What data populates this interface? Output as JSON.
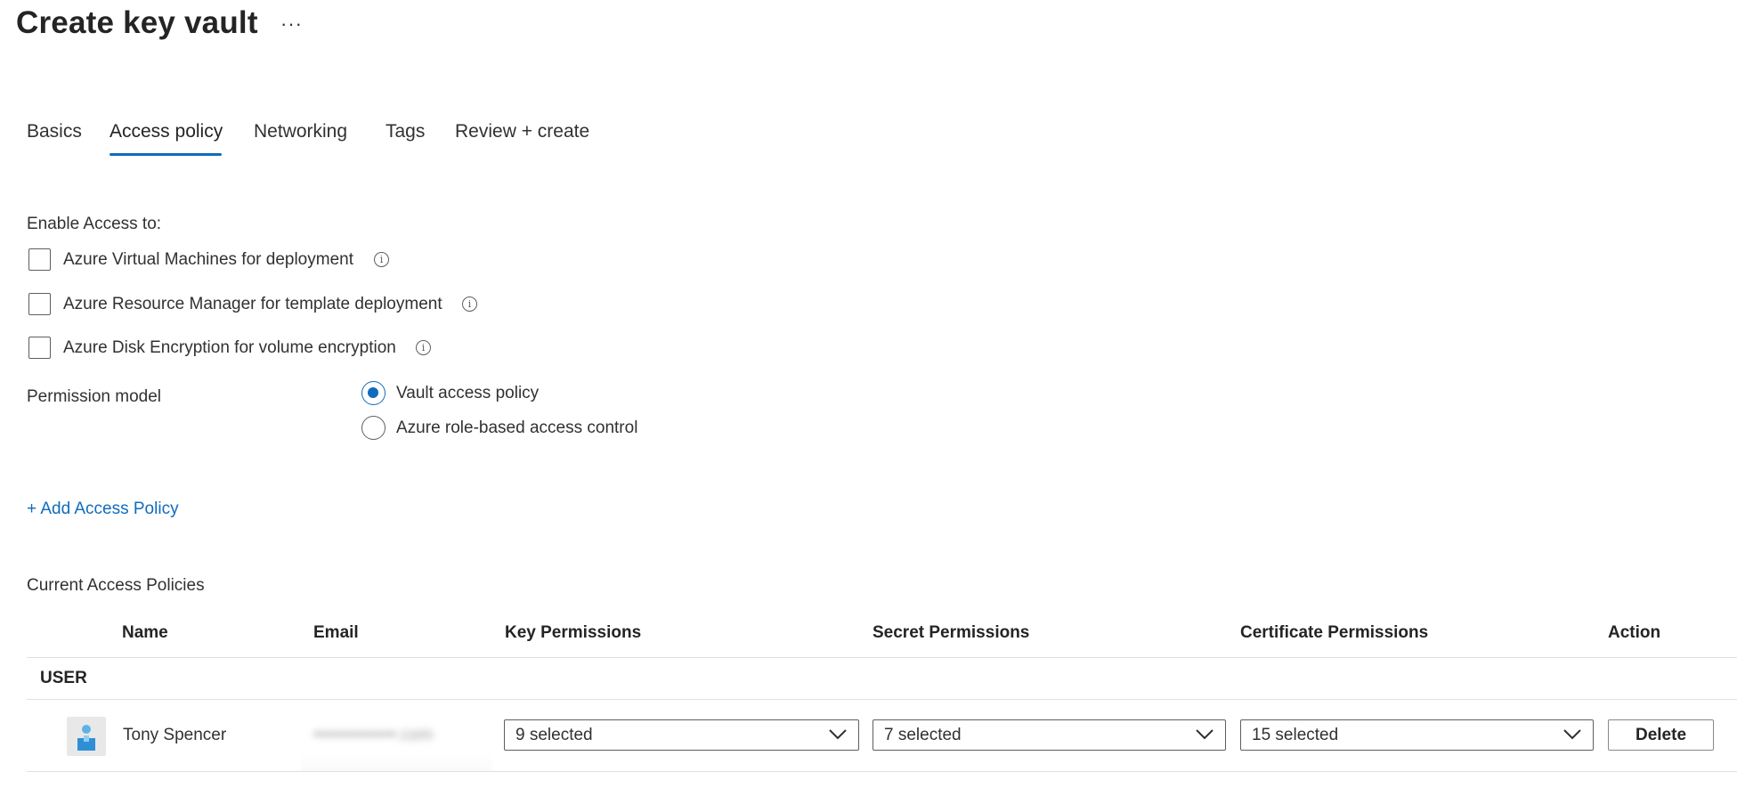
{
  "page": {
    "title": "Create key vault",
    "more_label": "···"
  },
  "tabs": [
    {
      "label": "Basics"
    },
    {
      "label": "Access policy",
      "active": true
    },
    {
      "label": "Networking"
    },
    {
      "label": "Tags"
    },
    {
      "label": "Review + create"
    }
  ],
  "access": {
    "heading": "Enable Access to:",
    "options": [
      {
        "label": "Azure Virtual Machines for deployment",
        "checked": false,
        "info_icon": "info-icon"
      },
      {
        "label": "Azure Resource Manager for template deployment",
        "checked": false,
        "info_icon": "info-icon"
      },
      {
        "label": "Azure Disk Encryption for volume encryption",
        "checked": false,
        "info_icon": "info-icon"
      }
    ]
  },
  "permission_model": {
    "label": "Permission model",
    "options": [
      {
        "label": "Vault access policy",
        "selected": true
      },
      {
        "label": "Azure role-based access control",
        "selected": false
      }
    ]
  },
  "add_policy": {
    "label": "+ Add Access Policy"
  },
  "policies": {
    "heading": "Current Access Policies",
    "columns": [
      "Name",
      "Email",
      "Key Permissions",
      "Secret Permissions",
      "Certificate Permissions",
      "Action"
    ],
    "groups": [
      {
        "label": "USER",
        "rows": [
          {
            "name": "Tony Spencer",
            "email": "••••••••••••••.com",
            "avatar_icon": "user-avatar-icon",
            "key_permissions": "9 selected",
            "secret_permissions": "7 selected",
            "certificate_permissions": "15 selected",
            "action": "Delete"
          }
        ]
      }
    ]
  },
  "colors": {
    "accent": "#0f6cbd",
    "text": "#323130",
    "border": "#605e5c",
    "divider": "#e1dfdd"
  }
}
